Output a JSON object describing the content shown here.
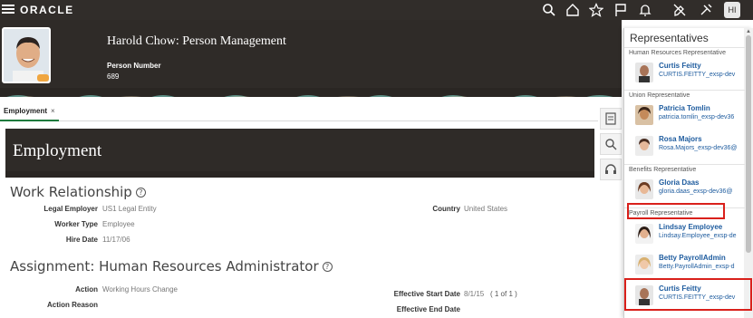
{
  "topbar": {
    "brand": "ORACLE",
    "user_initials": "HI",
    "icons": [
      "menu-icon",
      "search-icon",
      "home-icon",
      "star-icon",
      "flag-icon",
      "bell-icon",
      "tools-icon",
      "settings-icon"
    ]
  },
  "header": {
    "title": "Harold Chow: Person Management",
    "person_number_label": "Person Number",
    "person_number": "689"
  },
  "tabs": [
    {
      "label": "Employment",
      "close": "×"
    }
  ],
  "employment": {
    "title": "Employment",
    "work_relationship": {
      "heading": "Work Relationship",
      "legal_employer_label": "Legal Employer",
      "legal_employer": "US1 Legal Entity",
      "worker_type_label": "Worker Type",
      "worker_type": "Employee",
      "hire_date_label": "Hire Date",
      "hire_date": "11/17/06",
      "country_label": "Country",
      "country": "United States"
    },
    "assignment": {
      "heading": "Assignment: Human Resources Administrator",
      "action_label": "Action",
      "action": "Working Hours Change",
      "action_reason_label": "Action Reason",
      "effective_start_label": "Effective Start Date",
      "effective_start": "8/1/15",
      "record_count": "( 1 of 1 )",
      "effective_end_label": "Effective End Date"
    }
  },
  "representatives": {
    "title": "Representatives",
    "groups": [
      {
        "category": "Human Resources Representative",
        "people": [
          {
            "name": "Curtis Feitty",
            "email": "CURTIS.FEITTY_exsp-dev"
          }
        ]
      },
      {
        "category": "Union Representative",
        "people": [
          {
            "name": "Patricia Tomlin",
            "email": "patricia.tomlin_exsp-dev36"
          },
          {
            "name": "Rosa Majors",
            "email": "Rosa.Majors_exsp-dev36@"
          }
        ]
      },
      {
        "category": "Benefits Representative",
        "people": [
          {
            "name": "Gloria Daas",
            "email": "gloria.daas_exsp-dev36@"
          }
        ]
      },
      {
        "category": "Payroll Representative",
        "people": [
          {
            "name": "Lindsay Employee",
            "email": "Lindsay.Employee_exsp-de"
          },
          {
            "name": "Betty PayrollAdmin",
            "email": "Betty.PayrollAdmin_exsp-d"
          },
          {
            "name": "Curtis Feitty",
            "email": "CURTIS.FEITTY_exsp-dev"
          }
        ]
      }
    ]
  },
  "colors": {
    "brand_dark": "#312d2a",
    "link": "#1d5b9e",
    "highlight": "#d9201b"
  }
}
